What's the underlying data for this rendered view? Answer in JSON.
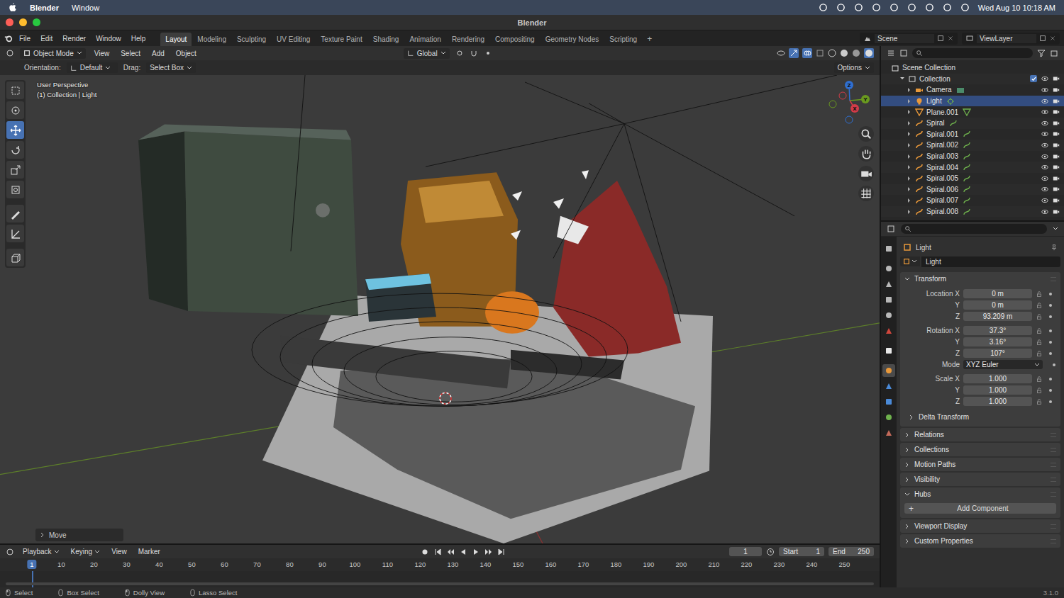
{
  "macos_menubar": {
    "app": "Blender",
    "menus": [
      "Window"
    ],
    "clock": "Wed Aug 10 10:18 AM"
  },
  "window": {
    "title": "Blender"
  },
  "topbar": {
    "menus": [
      "File",
      "Edit",
      "Render",
      "Window",
      "Help"
    ],
    "workspaces": [
      {
        "label": "Layout",
        "selected": true
      },
      {
        "label": "Modeling",
        "selected": false
      },
      {
        "label": "Sculpting",
        "selected": false
      },
      {
        "label": "UV Editing",
        "selected": false
      },
      {
        "label": "Texture Paint",
        "selected": false
      },
      {
        "label": "Shading",
        "selected": false
      },
      {
        "label": "Animation",
        "selected": false
      },
      {
        "label": "Rendering",
        "selected": false
      },
      {
        "label": "Compositing",
        "selected": false
      },
      {
        "label": "Geometry Nodes",
        "selected": false
      },
      {
        "label": "Scripting",
        "selected": false
      }
    ],
    "add_workspace": "+",
    "scene": "Scene",
    "view_layer": "ViewLayer"
  },
  "viewport": {
    "header": {
      "mode": "Object Mode",
      "menus": [
        "View",
        "Select",
        "Add",
        "Object"
      ],
      "transform_orientation": "Global"
    },
    "tool_settings": {
      "orientation_label": "Orientation:",
      "orientation": "Default",
      "drag_label": "Drag:",
      "drag": "Select Box",
      "options": "Options"
    },
    "overlay_text": [
      "User Perspective",
      "(1) Collection | Light"
    ],
    "tools": [
      {
        "selected": false
      },
      {
        "selected": false
      },
      {
        "selected": true
      },
      {
        "selected": false
      },
      {
        "selected": false
      },
      {
        "selected": false
      },
      {
        "selected": false
      },
      {
        "selected": false
      },
      {
        "selected": false
      }
    ],
    "gizmo_axes": [
      {
        "label": "Z",
        "color": "#2f6fd1"
      },
      {
        "label": "Y",
        "color": "#6a9a1f"
      },
      {
        "label": "X",
        "color": "#d33b48"
      }
    ],
    "last_operator": "Move"
  },
  "outliner": {
    "root": "Scene Collection",
    "collection": {
      "name": "Collection",
      "checked": true,
      "expanded": true
    },
    "objects": [
      {
        "name": "Camera",
        "kind": "camera",
        "selected": false,
        "expanded": false,
        "visible": true,
        "renderable": true
      },
      {
        "name": "Light",
        "kind": "light",
        "selected": true,
        "expanded": false,
        "visible": true,
        "renderable": true
      },
      {
        "name": "Plane.001",
        "kind": "mesh",
        "selected": false,
        "expanded": false,
        "visible": true,
        "renderable": true
      },
      {
        "name": "Spiral",
        "kind": "curve",
        "selected": false,
        "expanded": false,
        "visible": true,
        "renderable": true
      },
      {
        "name": "Spiral.001",
        "kind": "curve",
        "selected": false,
        "expanded": false,
        "visible": true,
        "renderable": true
      },
      {
        "name": "Spiral.002",
        "kind": "curve",
        "selected": false,
        "expanded": false,
        "visible": true,
        "renderable": true
      },
      {
        "name": "Spiral.003",
        "kind": "curve",
        "selected": false,
        "expanded": false,
        "visible": true,
        "renderable": true
      },
      {
        "name": "Spiral.004",
        "kind": "curve",
        "selected": false,
        "expanded": false,
        "visible": true,
        "renderable": true
      },
      {
        "name": "Spiral.005",
        "kind": "curve",
        "selected": false,
        "expanded": false,
        "visible": true,
        "renderable": true
      },
      {
        "name": "Spiral.006",
        "kind": "curve",
        "selected": false,
        "expanded": false,
        "visible": true,
        "renderable": true
      },
      {
        "name": "Spiral.007",
        "kind": "curve",
        "selected": false,
        "expanded": false,
        "visible": true,
        "renderable": true
      },
      {
        "name": "Spiral.008",
        "kind": "curve",
        "selected": false,
        "expanded": false,
        "visible": true,
        "renderable": true
      }
    ]
  },
  "properties": {
    "tabs": [
      {
        "selected": false
      },
      {
        "selected": false
      },
      {
        "selected": false
      },
      {
        "selected": false
      },
      {
        "selected": false
      },
      {
        "selected": false
      },
      {
        "selected": false
      },
      {
        "selected": true
      },
      {
        "selected": false
      },
      {
        "selected": false
      },
      {
        "selected": false
      },
      {
        "selected": false
      }
    ],
    "object_name": "Light",
    "datablock": "Light",
    "transform": {
      "label": "Transform",
      "expanded": true,
      "groups": [
        [
          {
            "label": "Location X",
            "value": "0 m",
            "kind": "number"
          },
          {
            "label": "Y",
            "value": "0 m",
            "kind": "number"
          },
          {
            "label": "Z",
            "value": "93.209 m",
            "kind": "number"
          }
        ],
        [
          {
            "label": "Rotation X",
            "value": "37.3°",
            "kind": "number"
          },
          {
            "label": "Y",
            "value": "3.16°",
            "kind": "number"
          },
          {
            "label": "Z",
            "value": "107°",
            "kind": "number"
          },
          {
            "label": "Mode",
            "value": "XYZ Euler",
            "kind": "dropdown"
          }
        ],
        [
          {
            "label": "Scale X",
            "value": "1.000",
            "kind": "number"
          },
          {
            "label": "Y",
            "value": "1.000",
            "kind": "number"
          },
          {
            "label": "Z",
            "value": "1.000",
            "kind": "number"
          }
        ]
      ],
      "subpanel": {
        "label": "Delta Transform",
        "expanded": false
      }
    },
    "sections": [
      {
        "label": "Relations",
        "expanded": false,
        "button": "",
        "button_icon": ""
      },
      {
        "label": "Collections",
        "expanded": false,
        "button": "",
        "button_icon": ""
      },
      {
        "label": "Motion Paths",
        "expanded": false,
        "button": "",
        "button_icon": ""
      },
      {
        "label": "Visibility",
        "expanded": false,
        "button": "",
        "button_icon": ""
      },
      {
        "label": "Hubs",
        "expanded": true,
        "button": "Add Component",
        "button_icon": "+"
      },
      {
        "label": "Viewport Display",
        "expanded": false,
        "button": "",
        "button_icon": ""
      },
      {
        "label": "Custom Properties",
        "expanded": false,
        "button": "",
        "button_icon": ""
      }
    ]
  },
  "timeline": {
    "menus": [
      {
        "label": "Playback",
        "dropdown": true
      },
      {
        "label": "Keying",
        "dropdown": true
      },
      {
        "label": "View",
        "dropdown": false
      },
      {
        "label": "Marker",
        "dropdown": false
      }
    ],
    "current_frame": "1",
    "start": {
      "label": "Start",
      "value": "1"
    },
    "end": {
      "label": "End",
      "value": "250"
    },
    "ruler": [
      "10",
      "20",
      "30",
      "40",
      "50",
      "60",
      "70",
      "80",
      "90",
      "100",
      "110",
      "120",
      "130",
      "140",
      "150",
      "160",
      "170",
      "180",
      "190",
      "200",
      "210",
      "220",
      "230",
      "240",
      "250"
    ]
  },
  "status_bar": {
    "hints": [
      "Select",
      "Box Select",
      "Dolly View",
      "Lasso Select"
    ],
    "version": "3.1.0"
  }
}
